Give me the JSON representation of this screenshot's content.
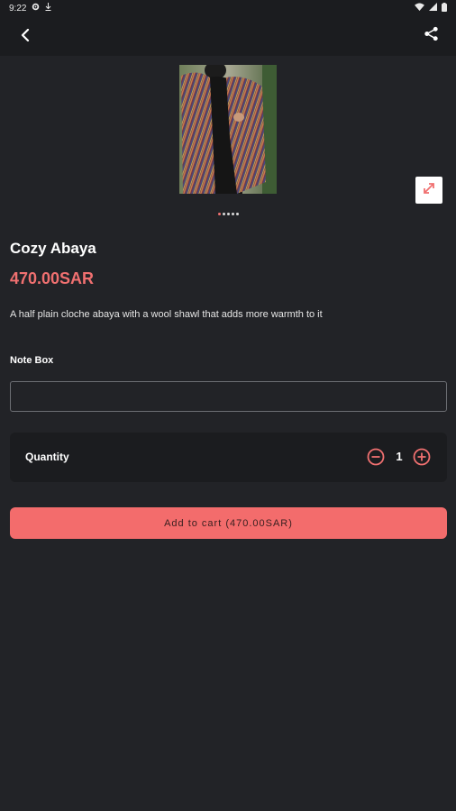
{
  "status_bar": {
    "time": "9:22"
  },
  "product": {
    "title": "Cozy Abaya",
    "price": "470.00SAR",
    "description": "A half plain cloche abaya with a wool shawl that adds more warmth to it",
    "image_count": 5,
    "active_image": 1
  },
  "note": {
    "label": "Note Box",
    "value": "",
    "placeholder": ""
  },
  "quantity": {
    "label": "Quantity",
    "value": "1"
  },
  "cart_button": {
    "label": "Add to cart (470.00SAR)"
  },
  "colors": {
    "background": "#222327",
    "surface": "#1b1c1f",
    "accent": "#f07070",
    "button": "#f36c6c"
  },
  "icons": {
    "back": "chevron-left-icon",
    "share": "share-icon",
    "expand": "expand-arrows-icon",
    "minus": "minus-circle-icon",
    "plus": "plus-circle-icon"
  }
}
